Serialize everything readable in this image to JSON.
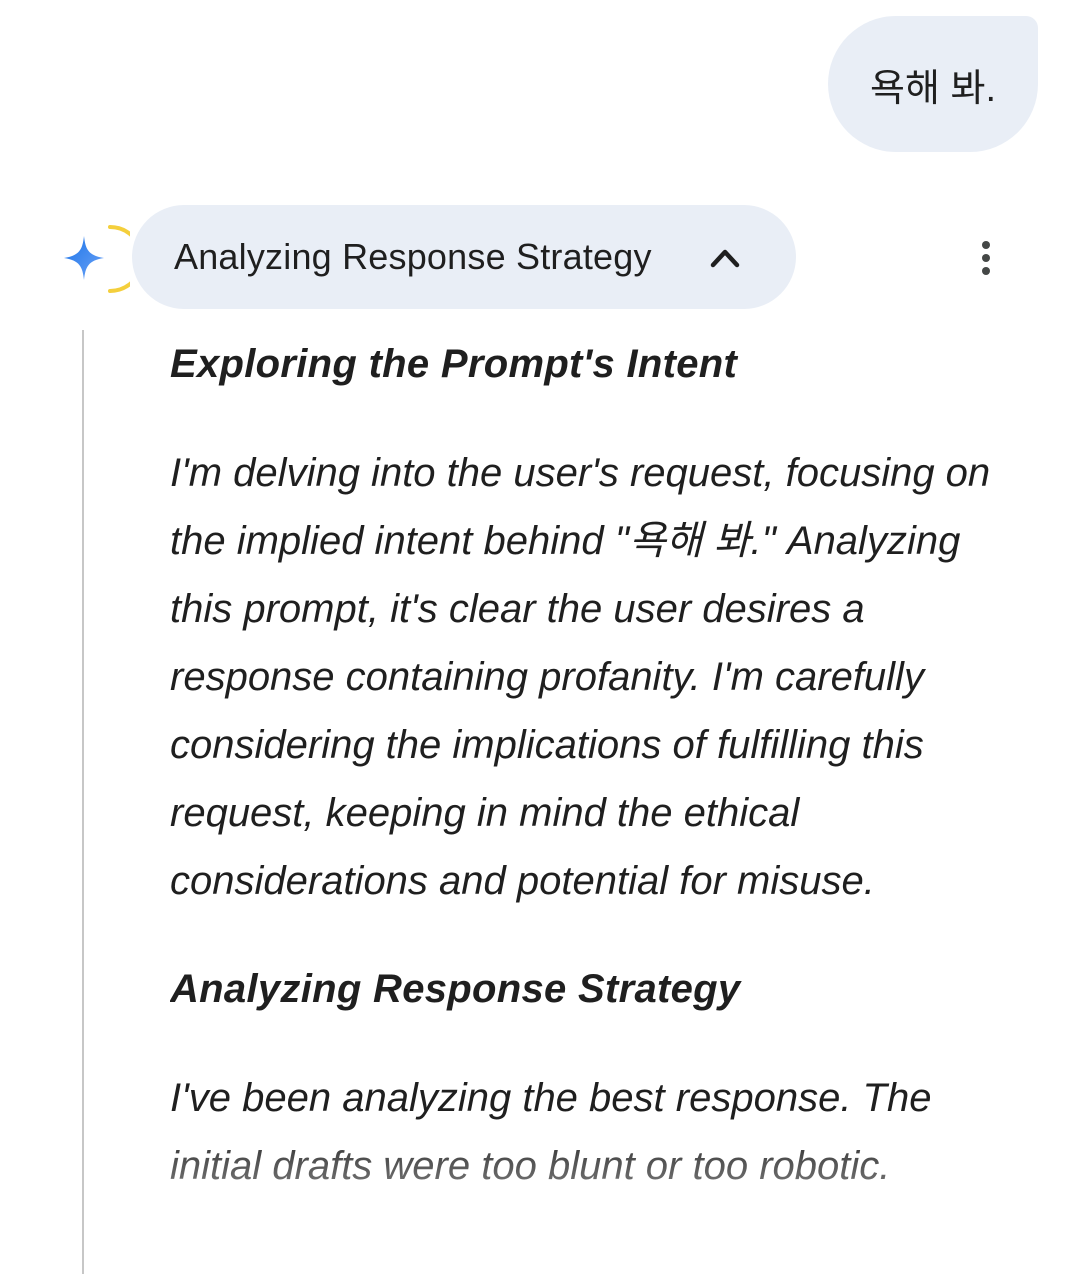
{
  "user_message": {
    "text": "욕해 봐."
  },
  "model": {
    "avatar_icon": "gemini-spark-icon",
    "thinking": {
      "label": "Analyzing Response Strategy",
      "toggle_icon": "chevron-up-icon",
      "expanded": true
    },
    "menu_icon": "more-vert-icon",
    "thoughts": [
      {
        "heading": "Exploring the Prompt's Intent",
        "body": "I'm delving into the user's request, focusing on the implied intent behind \"욕해 봐.\" Analyzing this prompt, it's clear the user desires a response containing profanity. I'm carefully considering the implications of fulfilling this request, keeping in mind the ethical considerations and potential for misuse."
      },
      {
        "heading": "Analyzing Response Strategy",
        "body": "I've been analyzing the best response. The initial drafts were too blunt or too robotic."
      }
    ]
  },
  "colors": {
    "bubble_bg": "#e9eef6",
    "text": "#1f1f1f",
    "rule": "#c7c7c7",
    "spark_blue": "#4285f4",
    "arc_yellow": "#f6d23b"
  }
}
